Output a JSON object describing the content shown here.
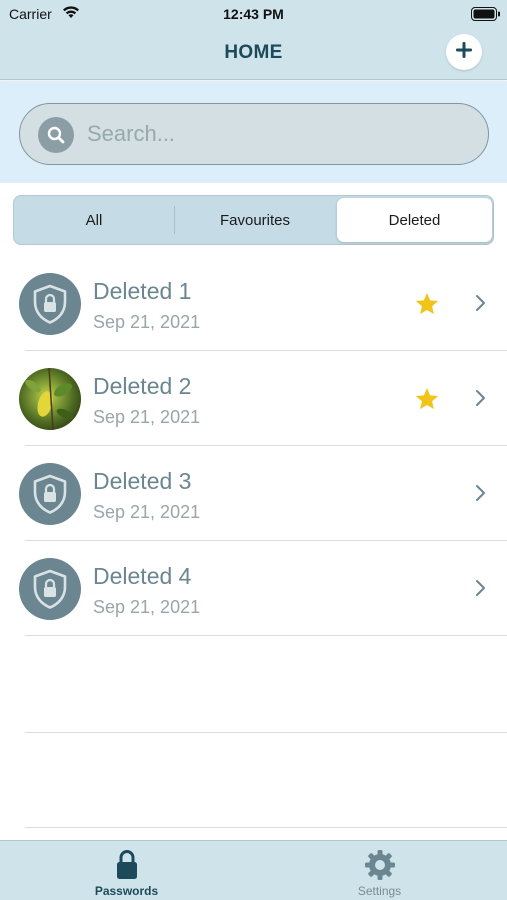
{
  "status_bar": {
    "carrier": "Carrier",
    "time": "12:43 PM"
  },
  "nav": {
    "title": "HOME",
    "add_icon": "plus-icon"
  },
  "search": {
    "placeholder": "Search...",
    "value": "",
    "icon": "search-icon"
  },
  "segments": {
    "all": "All",
    "favourites": "Favourites",
    "deleted": "Deleted",
    "selected": "Deleted"
  },
  "items": [
    {
      "title": "Deleted 1",
      "date": "Sep 21, 2021",
      "favourite": true,
      "avatar": "shield-lock-icon"
    },
    {
      "title": "Deleted 2",
      "date": "Sep 21, 2021",
      "favourite": true,
      "avatar": "photo"
    },
    {
      "title": "Deleted 3",
      "date": "Sep 21, 2021",
      "favourite": false,
      "avatar": "shield-lock-icon"
    },
    {
      "title": "Deleted 4",
      "date": "Sep 21, 2021",
      "favourite": false,
      "avatar": "shield-lock-icon"
    }
  ],
  "tabs": {
    "passwords": "Passwords",
    "settings": "Settings",
    "active": "Passwords"
  },
  "colors": {
    "bar_background": "#cfe3ea",
    "search_background": "#dbeefa",
    "accent": "#1c4a5a",
    "item_title": "#6b8690",
    "star": "#f0c419"
  }
}
